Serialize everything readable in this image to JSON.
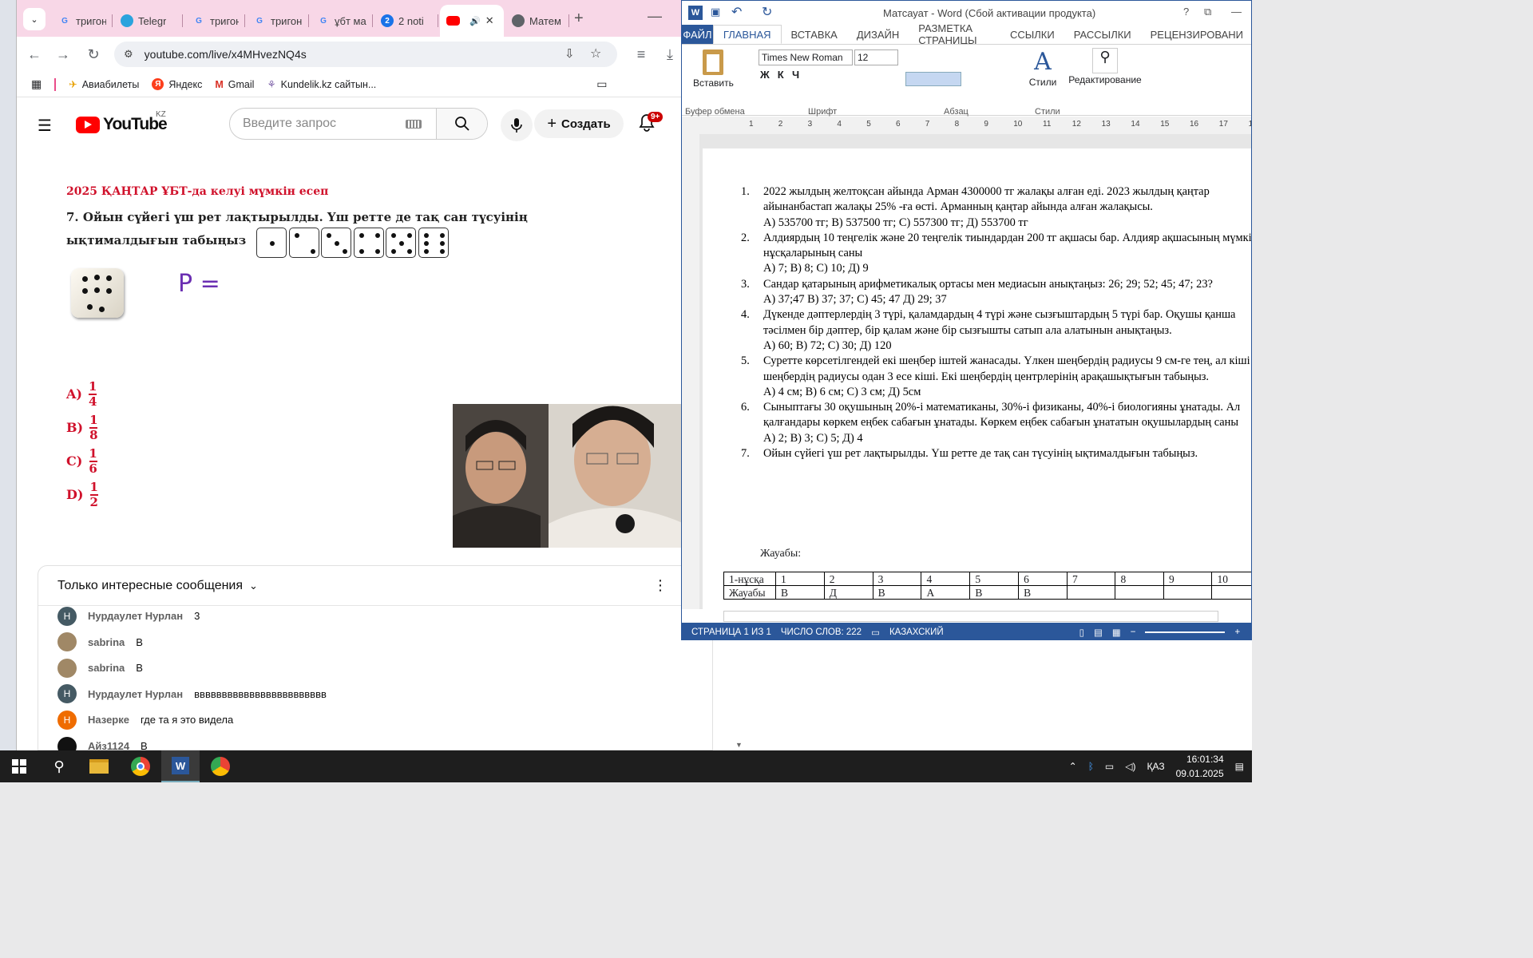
{
  "chrome": {
    "tabs": [
      {
        "label": "тригон",
        "icon": "google-icon",
        "color": "#4285f4"
      },
      {
        "label": "Telegr",
        "icon": "telegram-icon",
        "color": "#2aa3dd"
      },
      {
        "label": "тригон",
        "icon": "google-icon",
        "color": "#4285f4"
      },
      {
        "label": "тригон",
        "icon": "google-icon",
        "color": "#4285f4"
      },
      {
        "label": "ұбт ма",
        "icon": "google-icon",
        "color": "#4285f4"
      },
      {
        "label": "2 noti",
        "icon": "notification-icon",
        "color": "#1a73e8"
      },
      {
        "label": "",
        "icon": "youtube-icon",
        "color": "#ff0000",
        "active": true
      },
      {
        "label": "Матем",
        "icon": "globe-icon",
        "color": "#5f6368"
      }
    ],
    "url": "youtube.com/live/x4MHvezNQ4s",
    "bookmarks": [
      "Авиабилеты",
      "Яндекс",
      "Gmail",
      "Kundelik.kz сайтын..."
    ]
  },
  "youtube": {
    "logo": "YouTube",
    "region": "KZ",
    "search_placeholder": "Введите запрос",
    "create_label": "Создать",
    "notifications_badge": "9+"
  },
  "video": {
    "title": "2025 ҚАҢТАР ҰБТ-да келуі мүмкін есеп",
    "question": "7. Ойын сүйегі үш рет лақтырылды. Үш ретте де тақ сан түсуінің ықтималдығын табыңыз",
    "handwritten": "P =",
    "answers": [
      {
        "letter": "A)",
        "num": "1",
        "den": "4"
      },
      {
        "letter": "B)",
        "num": "1",
        "den": "8"
      },
      {
        "letter": "C)",
        "num": "1",
        "den": "6"
      },
      {
        "letter": "D)",
        "num": "1",
        "den": "2"
      }
    ]
  },
  "chat": {
    "header": "Только интересные сообщения",
    "messages": [
      {
        "avatar": "Н",
        "author": "Нурдаулет Нурлан",
        "text": "3",
        "color": "#455a64"
      },
      {
        "avatar": "",
        "author": "sabrina",
        "text": "B",
        "color": "#a08866"
      },
      {
        "avatar": "",
        "author": "sabrina",
        "text": "B",
        "color": "#a08866"
      },
      {
        "avatar": "Н",
        "author": "Нурдаулет Нурлан",
        "text": "вввввввввввввввввввввввв",
        "color": "#455a64"
      },
      {
        "avatar": "Н",
        "author": "Назерке",
        "text": "где та я это видела",
        "color": "#ef6c00"
      },
      {
        "avatar": "",
        "author": "Айз1124",
        "text": "B",
        "color": "#111111"
      }
    ]
  },
  "word": {
    "title": "Матсауат - Word (Сбой активации продукта)",
    "tabs": [
      "ФАЙЛ",
      "ГЛАВНАЯ",
      "ВСТАВКА",
      "ДИЗАЙН",
      "РАЗМЕТКА СТРАНИЦЫ",
      "ССЫЛКИ",
      "РАССЫЛКИ",
      "РЕЦЕНЗИРОВАНИ"
    ],
    "font": "Times New Roman",
    "font_size": "12",
    "paste": "Вставить",
    "styles": "Стили",
    "editing": "Редактирование",
    "groups": [
      "Буфер обмена",
      "Шрифт",
      "Абзац",
      "Стили"
    ],
    "questions": [
      {
        "n": "1.",
        "lines": [
          "2022 жылдың желтоқсан айында Арман 4300000 тг жалақы алған еді. 2023 жылдың қаңтар айынанбастап жалақы 25% -ға өсті. Арманның қаңтар айында алған жалақысы.",
          "А) 535700 тг; В) 537500 тг; С) 557300 тг; Д) 553700 тг"
        ]
      },
      {
        "n": "2.",
        "lines": [
          "Алдиярдың 10 теңгелік және 20 теңгелік тиындардан 200 тг ақшасы бар. Алдияр ақшасының мүмкін нұсқаларының саны",
          "А) 7;   В) 8;  С) 10;  Д) 9"
        ]
      },
      {
        "n": "3.",
        "lines": [
          "Сандар қатарының арифметикалық ортасы мен медиасын анықтаңыз: 26; 29; 52; 45; 47; 23?",
          "А)  37;47   В) 37; 37;   С) 45; 47   Д) 29; 37"
        ]
      },
      {
        "n": "4.",
        "lines": [
          "Дүкенде дәптерлердің 3 түрі, қаламдардың 4 түрі және сызғыштардың 5 түрі бар. Оқушы қанша тәсілмен бір дәптер, бір қалам және бір сызғышты сатып ала алатынын анықтаңыз.",
          "А) 60;  В) 72;  С) 30;  Д) 120"
        ]
      },
      {
        "n": "5.",
        "lines": [
          "Суретте көрсетілгендей екі шеңбер іштей жанасады. Үлкен шеңбердің радиусы 9 см-ге тең, ал кіші шеңбердің радиусы одан 3 есе кіші. Екі шеңбердің центрлерінің арақашықтығын табыңыз.",
          "А) 4 см;   В) 6 см;   С) 3 см;  Д) 5см"
        ]
      },
      {
        "n": "6.",
        "lines": [
          "Сыныптағы 30 оқушының 20%-і математиканы, 30%-і физиканы, 40%-і биологияны ұнатады. Ал қалғандары көркем еңбек сабағын ұнатады. Көркем еңбек сабағын ұнататын оқушылардың саны",
          "А) 2; В) 3; С) 5; Д) 4"
        ]
      },
      {
        "n": "7.",
        "lines": [
          "Ойын сүйегі үш рет лақтырылды. Үш ретте де тақ сан түсуінің ықтималдығын табыңыз."
        ]
      }
    ],
    "answers_label": "Жауабы:",
    "table": {
      "row1": [
        "1-нұсқа",
        "1",
        "2",
        "3",
        "4",
        "5",
        "6",
        "7",
        "8",
        "9",
        "10"
      ],
      "row2": [
        "Жауабы",
        "В",
        "Д",
        "В",
        "А",
        "В",
        "В",
        "",
        "",
        "",
        ""
      ]
    },
    "status": {
      "page": "СТРАНИЦА 1 ИЗ 1",
      "words": "ЧИСЛО СЛОВ: 222",
      "lang": "КАЗАХСКИЙ"
    }
  },
  "taskbar": {
    "lang": "ҚАЗ",
    "time": "16:01:34",
    "date": "09.01.2025"
  }
}
